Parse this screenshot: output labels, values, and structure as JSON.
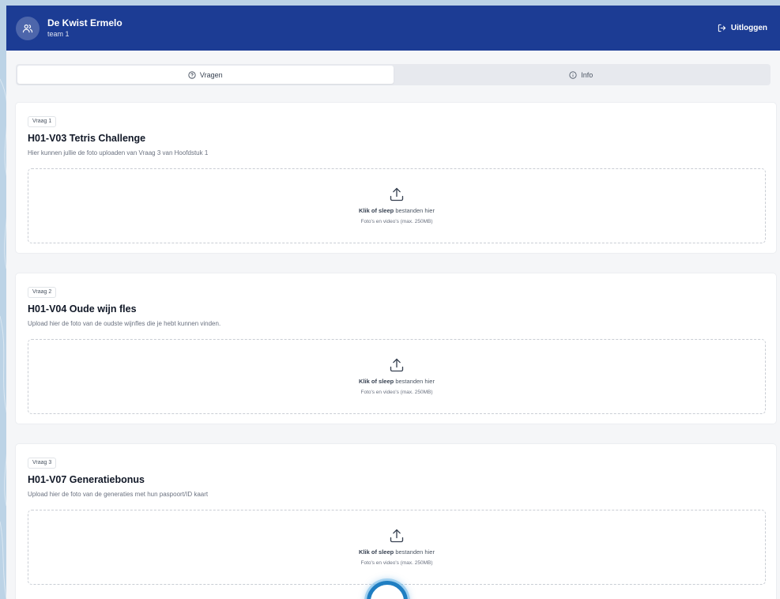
{
  "header": {
    "team_name": "De Kwist Ermelo",
    "team_sub": "team 1",
    "logout_label": "Uitloggen",
    "bg_color": "#1c3c94"
  },
  "tabs": [
    {
      "label": "Vragen",
      "active": true,
      "icon": "help-circle-icon"
    },
    {
      "label": "Info",
      "active": false,
      "icon": "info-circle-icon"
    }
  ],
  "questions": [
    {
      "badge": "Vraag 1",
      "title": "H01-V03 Tetris Challenge",
      "description": "Hier kunnen jullie de foto uploaden van Vraag 3 van Hoofdstuk 1",
      "upload_main_bold": "Klik of sleep",
      "upload_main_rest": " bestanden hier",
      "upload_sub": "Foto's en video's (max. 250MB)"
    },
    {
      "badge": "Vraag 2",
      "title": "H01-V04 Oude wijn fles",
      "description": "Upload hier de foto van de oudste wijnfles die je hebt kunnen vinden.",
      "upload_main_bold": "Klik of sleep",
      "upload_main_rest": " bestanden hier",
      "upload_sub": "Foto's en video's (max. 250MB)"
    },
    {
      "badge": "Vraag 3",
      "title": "H01-V07 Generatiebonus",
      "description": "Upload hier de foto van de generaties met hun paspoort/ID kaart",
      "upload_main_bold": "Klik of sleep",
      "upload_main_rest": " bestanden hier",
      "upload_sub": "Foto's en video's (max. 250MB)"
    }
  ]
}
